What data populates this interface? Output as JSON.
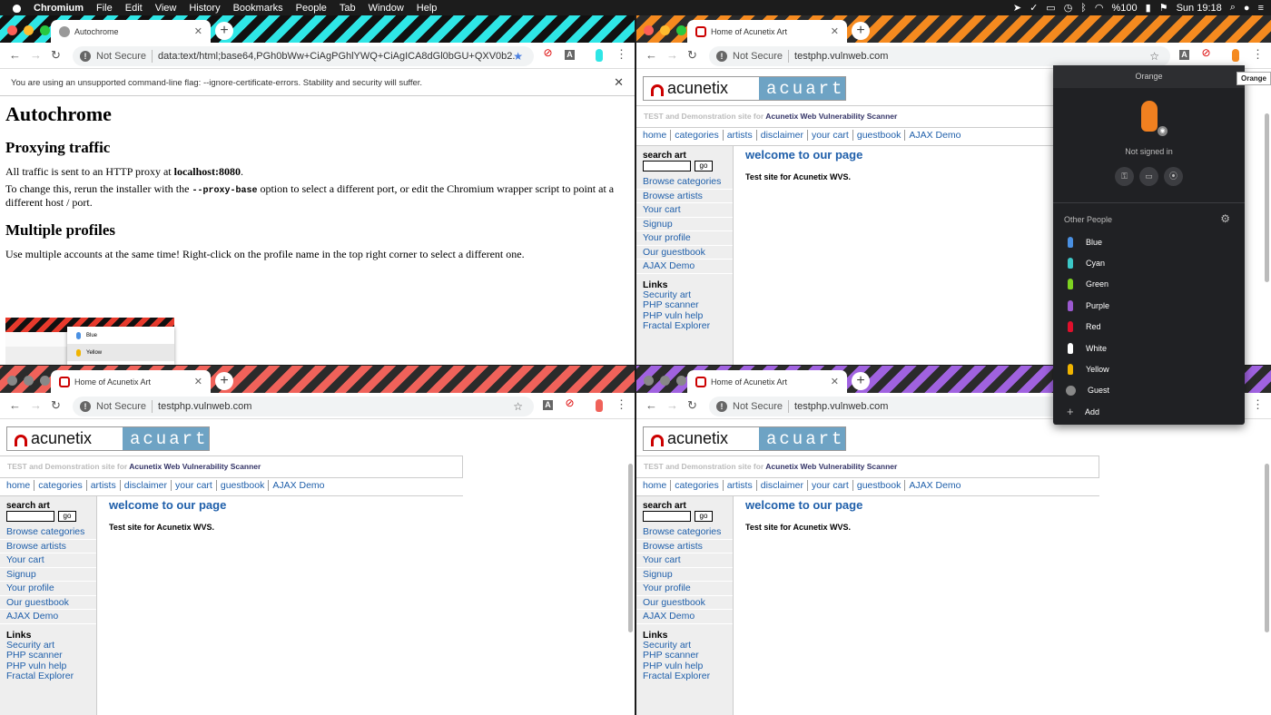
{
  "menubar": {
    "app": "Chromium",
    "items": [
      "File",
      "Edit",
      "View",
      "History",
      "Bookmarks",
      "People",
      "Tab",
      "Window",
      "Help"
    ],
    "battery": "%100",
    "clock": "Sun 19:18"
  },
  "window1": {
    "tab_title": "Autochrome",
    "url": "data:text/html;base64,PGh0bWw+CiAgPGhlYWQ+CiAgICA8dGl0bGU+QXV0b2...",
    "infobar": "You are using an unsupported command-line flag: --ignore-certificate-errors. Stability and security will suffer.",
    "page": {
      "h1": "Autochrome",
      "h2a": "Proxying traffic",
      "p1a": "All traffic is sent to an HTTP proxy at ",
      "p1b": "localhost:8080",
      "p1c": ".",
      "p2a": "To change this, rerun the installer with the ",
      "p2code": "--proxy-base",
      "p2b": " option to select a different port, or edit the Chromium wrapper script to point at a different host / port.",
      "h2b": "Multiple profiles",
      "p3": "Use multiple accounts at the same time! Right-click on the profile name in the top right corner to select a different one.",
      "shot_blue": "Blue",
      "shot_yellow": "Yellow"
    }
  },
  "acunetix": {
    "tab_title": "Home of Acunetix Art",
    "url": "testphp.vulnweb.com",
    "not_secure": "Not Secure",
    "logo_left": "acunetix",
    "logo_right": "acuart",
    "subtitle_a": "TEST and Demonstration site for ",
    "subtitle_b": "Acunetix Web Vulnerability Scanner",
    "topnav": [
      "home",
      "categories",
      "artists",
      "disclaimer",
      "your cart",
      "guestbook",
      "AJAX Demo"
    ],
    "search_label": "search art",
    "go": "go",
    "side": [
      "Browse categories",
      "Browse artists",
      "Your cart",
      "Signup",
      "Your profile",
      "Our guestbook",
      "AJAX Demo"
    ],
    "links_header": "Links",
    "links": [
      "Security art",
      "PHP scanner",
      "PHP vuln help",
      "Fractal Explorer"
    ],
    "welcome": "welcome to our page",
    "test_site": "Test site for Acunetix WVS."
  },
  "profile_popup": {
    "header": "Orange",
    "status": "Not signed in",
    "other_people": "Other People",
    "tooltip": "Orange",
    "people": [
      {
        "name": "Blue",
        "color": "#4a90e2"
      },
      {
        "name": "Cyan",
        "color": "#3cc8c8"
      },
      {
        "name": "Green",
        "color": "#7ed321"
      },
      {
        "name": "Purple",
        "color": "#9b59d0"
      },
      {
        "name": "Red",
        "color": "#e0102c"
      },
      {
        "name": "White",
        "color": "#ffffff"
      },
      {
        "name": "Yellow",
        "color": "#f0b400"
      }
    ],
    "guest": "Guest",
    "add": "Add"
  },
  "colors": {
    "cyan": "#2ee6e6",
    "orange": "#f58a1f",
    "red": "#f0625a",
    "purple": "#a062e0"
  }
}
